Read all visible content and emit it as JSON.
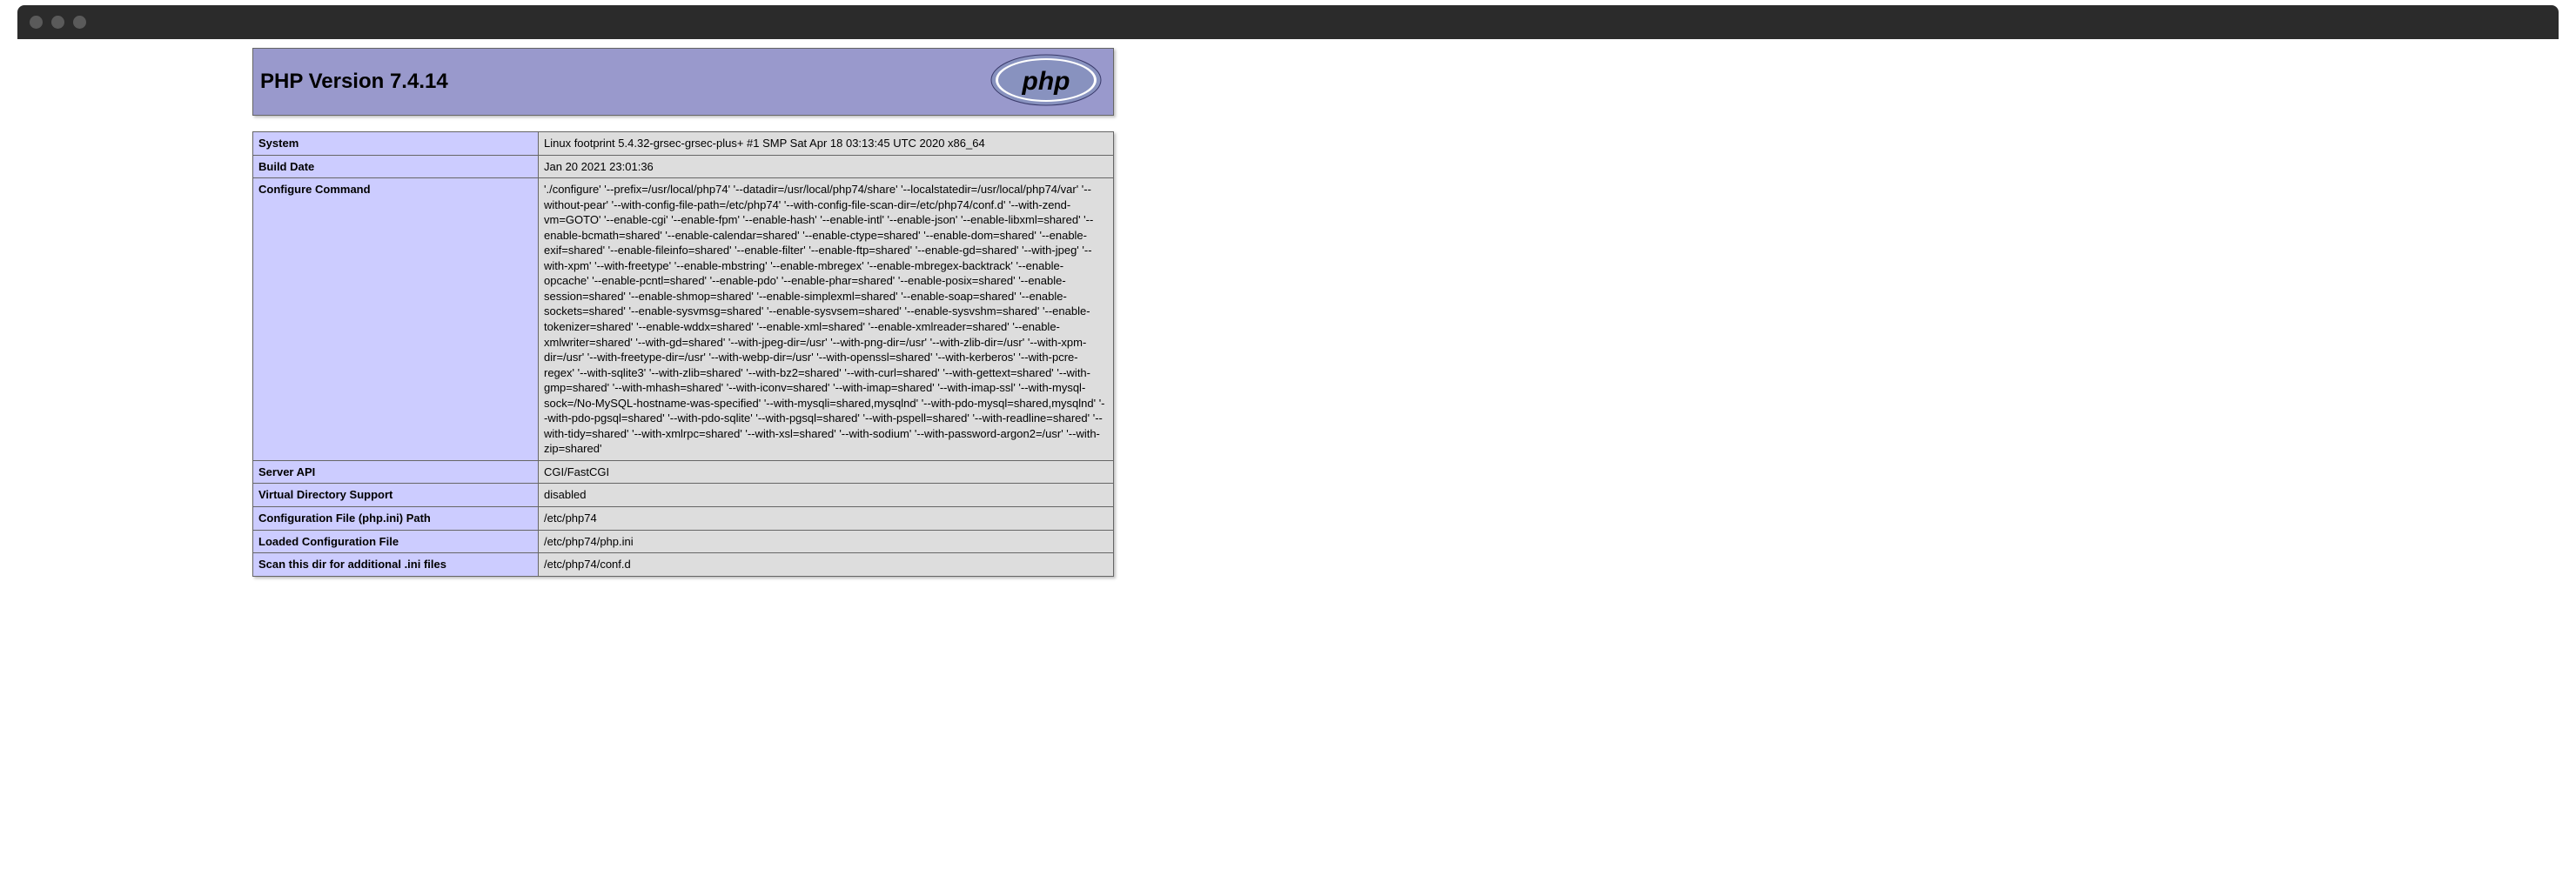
{
  "header": {
    "title": "PHP Version 7.4.14"
  },
  "rows": [
    {
      "label": "System",
      "value": "Linux footprint 5.4.32-grsec-grsec-plus+ #1 SMP Sat Apr 18 03:13:45 UTC 2020 x86_64"
    },
    {
      "label": "Build Date",
      "value": "Jan 20 2021 23:01:36"
    },
    {
      "label": "Configure Command",
      "value": "'./configure' '--prefix=/usr/local/php74' '--datadir=/usr/local/php74/share' '--localstatedir=/usr/local/php74/var' '--without-pear' '--with-config-file-path=/etc/php74' '--with-config-file-scan-dir=/etc/php74/conf.d' '--with-zend-vm=GOTO' '--enable-cgi' '--enable-fpm' '--enable-hash' '--enable-intl' '--enable-json' '--enable-libxml=shared' '--enable-bcmath=shared' '--enable-calendar=shared' '--enable-ctype=shared' '--enable-dom=shared' '--enable-exif=shared' '--enable-fileinfo=shared' '--enable-filter' '--enable-ftp=shared' '--enable-gd=shared' '--with-jpeg' '--with-xpm' '--with-freetype' '--enable-mbstring' '--enable-mbregex' '--enable-mbregex-backtrack' '--enable-opcache' '--enable-pcntl=shared' '--enable-pdo' '--enable-phar=shared' '--enable-posix=shared' '--enable-session=shared' '--enable-shmop=shared' '--enable-simplexml=shared' '--enable-soap=shared' '--enable-sockets=shared' '--enable-sysvmsg=shared' '--enable-sysvsem=shared' '--enable-sysvshm=shared' '--enable-tokenizer=shared' '--enable-wddx=shared' '--enable-xml=shared' '--enable-xmlreader=shared' '--enable-xmlwriter=shared' '--with-gd=shared' '--with-jpeg-dir=/usr' '--with-png-dir=/usr' '--with-zlib-dir=/usr' '--with-xpm-dir=/usr' '--with-freetype-dir=/usr' '--with-webp-dir=/usr' '--with-openssl=shared' '--with-kerberos' '--with-pcre-regex' '--with-sqlite3' '--with-zlib=shared' '--with-bz2=shared' '--with-curl=shared' '--with-gettext=shared' '--with-gmp=shared' '--with-mhash=shared' '--with-iconv=shared' '--with-imap=shared' '--with-imap-ssl' '--with-mysql-sock=/No-MySQL-hostname-was-specified' '--with-mysqli=shared,mysqlnd' '--with-pdo-mysql=shared,mysqlnd' '--with-pdo-pgsql=shared' '--with-pdo-sqlite' '--with-pgsql=shared' '--with-pspell=shared' '--with-readline=shared' '--with-tidy=shared' '--with-xmlrpc=shared' '--with-xsl=shared' '--with-sodium' '--with-password-argon2=/usr' '--with-zip=shared'"
    },
    {
      "label": "Server API",
      "value": "CGI/FastCGI"
    },
    {
      "label": "Virtual Directory Support",
      "value": "disabled"
    },
    {
      "label": "Configuration File (php.ini) Path",
      "value": "/etc/php74"
    },
    {
      "label": "Loaded Configuration File",
      "value": "/etc/php74/php.ini"
    },
    {
      "label": "Scan this dir for additional .ini files",
      "value": "/etc/php74/conf.d"
    }
  ]
}
